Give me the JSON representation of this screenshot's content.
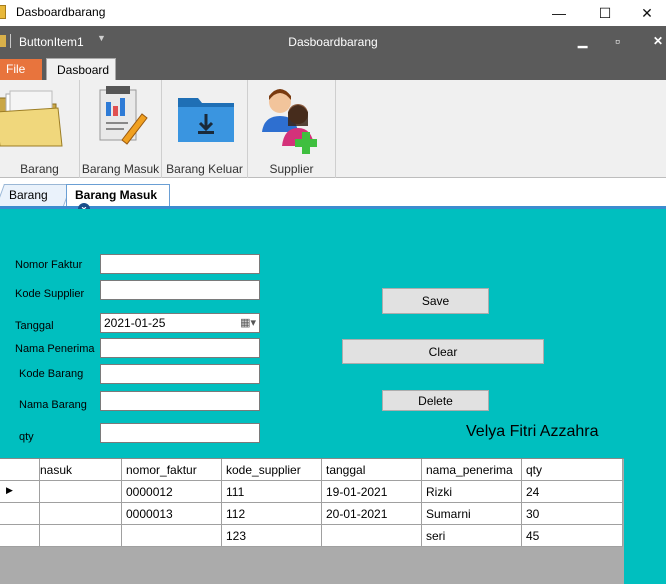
{
  "window": {
    "title": "Dasboardbarang",
    "minimize": "—",
    "maximize": "☐",
    "close": "✕"
  },
  "ribbon": {
    "quick_access_label": "ButtonItem1",
    "quick_access_arrow": "▼",
    "center_title": "Dasboardbarang",
    "mdi_min": "▁",
    "mdi_restore": "▫",
    "mdi_close": "✕",
    "tabs": {
      "file": "File",
      "dashboard": "Dasboard"
    },
    "groups": [
      {
        "label": "Barang",
        "icon": "folder-icon"
      },
      {
        "label": "Barang Masuk",
        "icon": "report-icon"
      },
      {
        "label": "Barang Keluar",
        "icon": "download-folder-icon"
      },
      {
        "label": "Supplier",
        "icon": "add-user-icon"
      }
    ]
  },
  "doc_tabs": {
    "barang": "Barang",
    "barang_masuk": "Barang Masuk",
    "close": "x"
  },
  "form": {
    "nomor_faktur": {
      "label": "Nomor Faktur",
      "value": ""
    },
    "kode_supplier": {
      "label": "Kode Supplier",
      "value": ""
    },
    "tanggal": {
      "label": "Tanggal",
      "value": "2021-01-25"
    },
    "nama_penerima": {
      "label": "Nama Penerima",
      "value": ""
    },
    "kode_barang": {
      "label": "Kode Barang",
      "value": ""
    },
    "nama_barang": {
      "label": "Nama Barang",
      "value": ""
    },
    "qty": {
      "label": "qty",
      "value": ""
    },
    "buttons": {
      "save": "Save",
      "clear": "Clear",
      "delete": "Delete"
    },
    "author": "Velya Fitri Azzahra"
  },
  "grid": {
    "columns": [
      "nasuk",
      "nomor_faktur",
      "kode_supplier",
      "tanggal",
      "nama_penerima",
      "qty"
    ],
    "rows": [
      [
        "",
        "0000012",
        "111",
        "19-01-2021",
        "Rizki",
        "24"
      ],
      [
        "",
        "0000013",
        "112",
        "20-01-2021",
        "Sumarni",
        "30"
      ],
      [
        "",
        "",
        "123",
        "",
        "seri",
        "45"
      ]
    ],
    "row_pointer": "▶"
  },
  "colors": {
    "form_background": "#00bfbf",
    "file_tab": "#e8743d",
    "ribbon_dark": "#5b5b5b"
  }
}
